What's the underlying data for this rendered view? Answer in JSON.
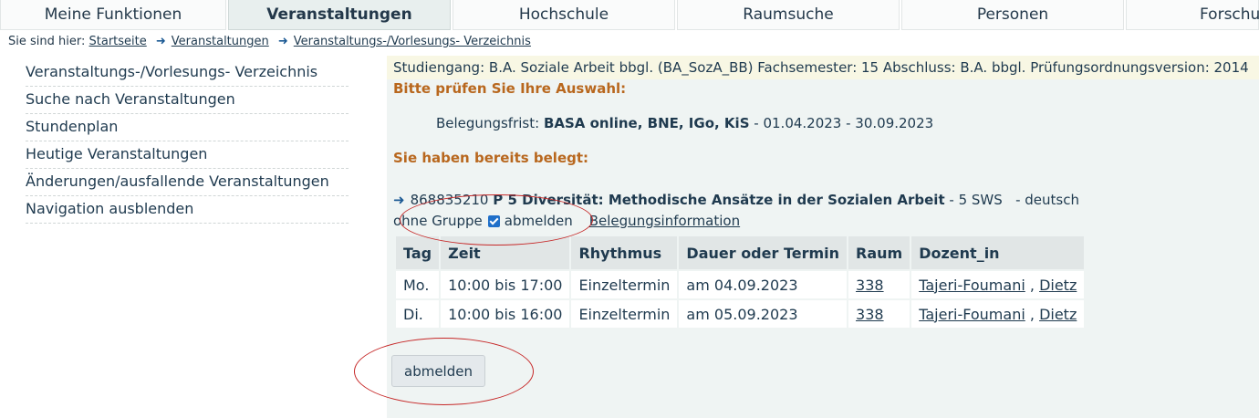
{
  "topnav": {
    "tabs": [
      {
        "label": "Meine Funktionen"
      },
      {
        "label": "Veranstaltungen"
      },
      {
        "label": "Hochschule"
      },
      {
        "label": "Raumsuche"
      },
      {
        "label": "Personen"
      },
      {
        "label": "Forschu"
      }
    ]
  },
  "breadcrumb": {
    "prefix": "Sie sind hier:",
    "items": [
      "Startseite",
      "Veranstaltungen",
      "Veranstaltungs-/Vorlesungs- Verzeichnis"
    ]
  },
  "leftmenu": {
    "items": [
      "Veranstaltungs-/Vorlesungs- Verzeichnis",
      "Suche nach Veranstaltungen",
      "Stundenplan",
      "Heutige Veranstaltungen",
      "Änderungen/ausfallende Veranstaltungen",
      "Navigation ausblenden"
    ]
  },
  "main": {
    "info": "Studiengang: B.A. Soziale Arbeit bbgl. (BA_SozA_BB) Fachsemester: 15 Abschluss: B.A. bbgl. Prüfungsordnungsversion: 2014",
    "check_heading": "Bitte prüfen Sie Ihre Auswahl:",
    "frist_label": "Belegungsfrist:",
    "frist_name": "BASA online, BNE, IGo, KiS",
    "frist_dates": "- 01.04.2023 - 30.09.2023",
    "booked_heading": "Sie haben bereits belegt:",
    "course": {
      "number": "868835210",
      "title": "P 5 Diversität: Methodische Ansätze in der Sozialen Arbeit",
      "details": "- 5 SWS   - deutsch",
      "group": "ohne Gruppe",
      "checkbox_label": "abmelden",
      "info_link": "Belegungsinformation"
    },
    "table": {
      "headers": [
        "Tag",
        "Zeit",
        "Rhythmus",
        "Dauer oder Termin",
        "Raum",
        "Dozent_in"
      ],
      "rows": [
        {
          "tag": "Mo.",
          "zeit": "10:00 bis 17:00",
          "rhythmus": "Einzeltermin",
          "termin": "am 04.09.2023",
          "raum": "338",
          "dozent1": "Tajeri-Foumani",
          "sep": ",",
          "dozent2": "Dietz"
        },
        {
          "tag": "Di.",
          "zeit": "10:00 bis 16:00",
          "rhythmus": "Einzeltermin",
          "termin": "am 05.09.2023",
          "raum": "338",
          "dozent1": "Tajeri-Foumani",
          "sep": ",",
          "dozent2": "Dietz"
        }
      ]
    },
    "button_label": "abmelden"
  },
  "colors": {
    "accent_orange": "#b8671e",
    "annotation_red": "#c62828",
    "checkbox_blue": "#1f6fc9"
  }
}
